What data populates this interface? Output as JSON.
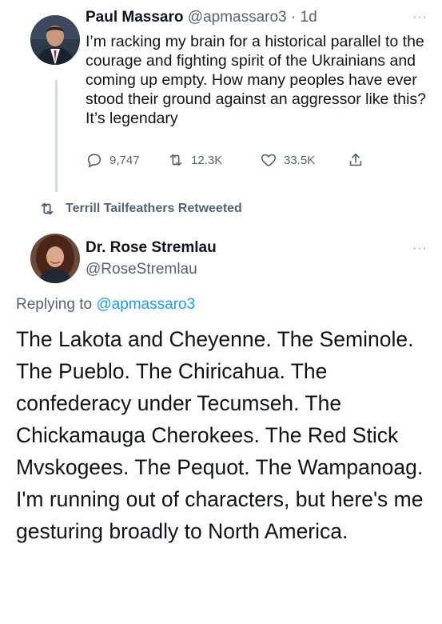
{
  "tweet1": {
    "author_name": "Paul Massaro",
    "handle": "@apmassaro3",
    "separator": "·",
    "time": "1d",
    "more_label": "···",
    "text": "I’m racking my brain for a historical parallel to the courage and fighting spirit of the Ukrainians and coming up empty. How many peoples have ever stood their ground against an aggressor like this? It’s legendary",
    "actions": {
      "reply_count": "9,747",
      "retweet_count": "12.3K",
      "like_count": "33.5K"
    },
    "icons": [
      "reply-icon",
      "retweet-icon",
      "like-icon",
      "share-icon"
    ]
  },
  "retweet_banner": {
    "label": "Terrill Tailfeathers Retweeted"
  },
  "tweet2": {
    "author_name": "Dr. Rose Stremlau",
    "handle": "@RoseStremlau",
    "more_label": "···",
    "replying_prefix": "Replying to ",
    "replying_handle": "@apmassaro3",
    "text": "The Lakota and Cheyenne. The Seminole. The Pueblo. The Chiricahua. The confederacy under Tecumseh. The Chickamauga Cherokees. The Red Stick Mvskogees. The Pequot. The Wampanoag. I'm running out of characters, but here's me gesturing broadly to North America."
  },
  "colors": {
    "text": "#0f1419",
    "muted": "#536471",
    "link": "#1d9bf0",
    "thread_line": "#cfd9de"
  }
}
